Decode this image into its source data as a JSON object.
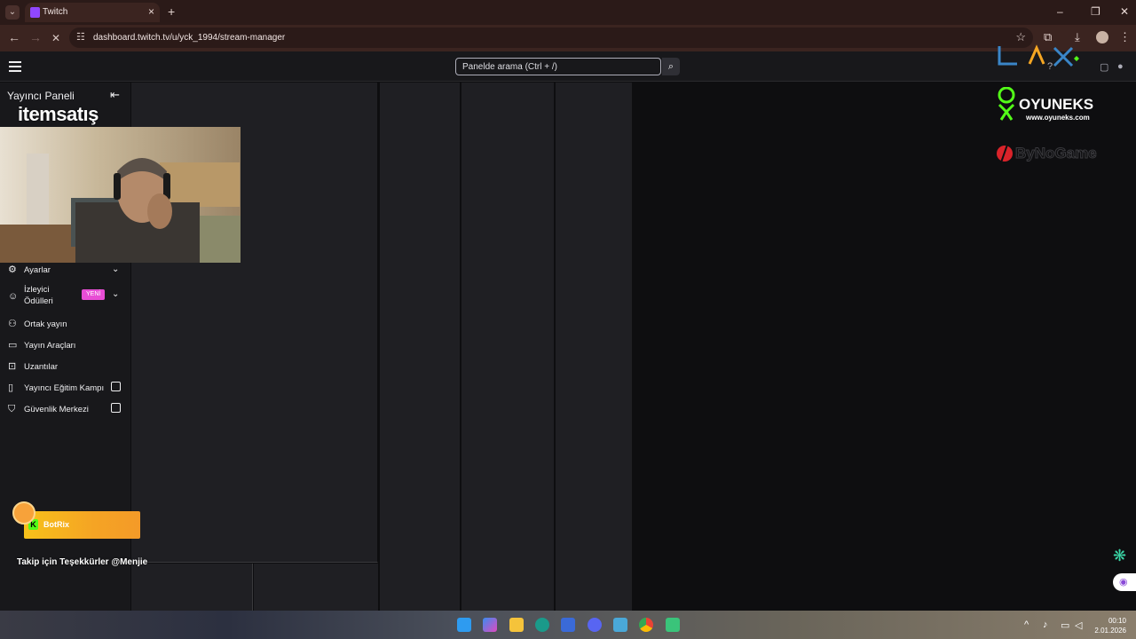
{
  "browser": {
    "tab_title": "Twitch",
    "new_tab": "+",
    "url": "dashboard.twitch.tv/u/yck_1994/stream-manager",
    "window_controls": {
      "minimize": "–",
      "maximize": "❐",
      "close": "✕"
    }
  },
  "topbar": {
    "search_placeholder": "Panelde arama (Ctrl + /)"
  },
  "sidebar": {
    "title": "Yayıncı Paneli",
    "items": [
      {
        "label": "Ayarlar",
        "icon": "gear-icon",
        "has_chevron": true
      },
      {
        "label": "İzleyici Ödülleri",
        "icon": "smile-icon",
        "has_chevron": true,
        "badge": "YENİ"
      },
      {
        "label": "Ortak yayın",
        "icon": "person-add-icon"
      },
      {
        "label": "Yayın Araçları",
        "icon": "video-icon"
      },
      {
        "label": "Uzantılar",
        "icon": "puzzle-icon"
      },
      {
        "label": "Yayıncı Eğitim Kampı",
        "icon": "book-icon",
        "external": true
      },
      {
        "label": "Güvenlik Merkezi",
        "icon": "shield-icon",
        "external": true
      }
    ]
  },
  "overlays": {
    "itemsatis_logo": "itemsatış",
    "oyuneks_title": "OYUNEKS",
    "oyuneks_url": "www.oyuneks.com",
    "bynogame": "ByNoGame",
    "botrix_name": "BotRix",
    "follow_message": "Takip için Teşekkürler @Menjie"
  },
  "taskbar": {
    "time": "00:10",
    "date": "2.01.2026"
  }
}
